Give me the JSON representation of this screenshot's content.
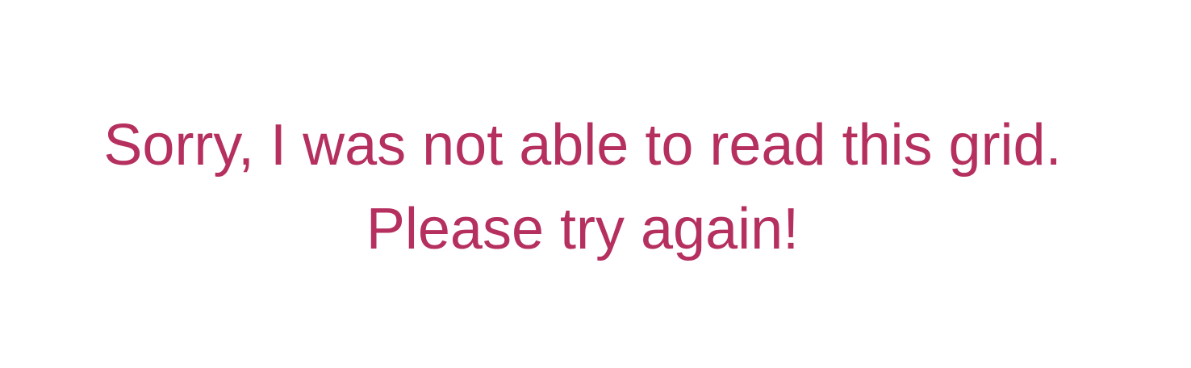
{
  "message": {
    "line1": "Sorry, I was not able to read this grid.",
    "line2": "Please try again!"
  },
  "colors": {
    "background": "#ffffff",
    "text": "#b5305f"
  }
}
